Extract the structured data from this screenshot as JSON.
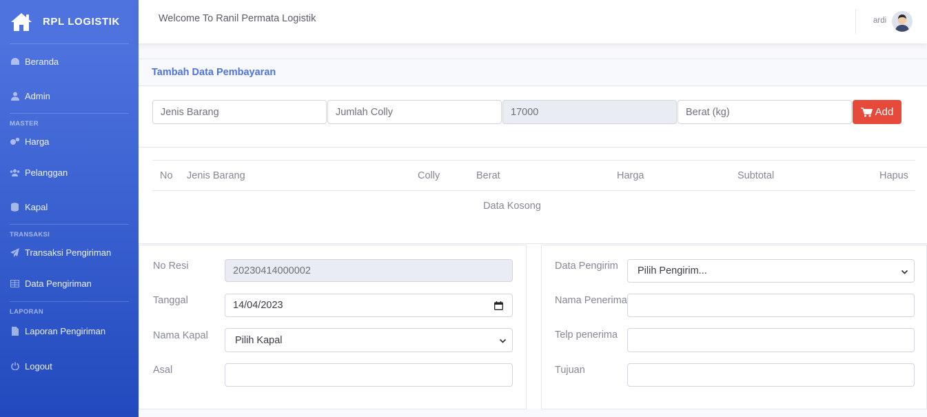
{
  "sidebar": {
    "brand": "RPL LOGISTIK",
    "items": [
      {
        "label": "Beranda",
        "icon": "tachometer-icon"
      },
      {
        "label": "Admin",
        "icon": "user-icon"
      },
      {
        "label": "Harga",
        "icon": "cogs-icon"
      },
      {
        "label": "Pelanggan",
        "icon": "users-icon"
      },
      {
        "label": "Kapal",
        "icon": "database-icon"
      },
      {
        "label": "Transaksi Pengiriman",
        "icon": "paper-plane-icon"
      },
      {
        "label": "Data Pengiriman",
        "icon": "table-icon"
      },
      {
        "label": "Laporan Pengiriman",
        "icon": "file-icon"
      },
      {
        "label": "Logout",
        "icon": "power-icon"
      }
    ],
    "headings": {
      "master": "MASTER",
      "transaksi": "TRANSAKSI",
      "laporan": "LAPORAN"
    }
  },
  "topbar": {
    "welcome": "Welcome To Ranil Permata Logistik",
    "username": "ardi"
  },
  "card": {
    "title": "Tambah Data Pembayaran"
  },
  "item_form": {
    "jenis_placeholder": "Jenis Barang",
    "colly_placeholder": "Jumlah Colly",
    "harga_value": "17000",
    "berat_placeholder": "Berat (kg)",
    "add_label": "Add"
  },
  "table": {
    "headers": [
      "No",
      "Jenis Barang",
      "Colly",
      "Berat",
      "Harga",
      "Subtotal",
      "Hapus"
    ],
    "empty": "Data Kosong"
  },
  "left_form": {
    "no_resi_label": "No Resi",
    "no_resi_value": "20230414000002",
    "tanggal_label": "Tanggal",
    "tanggal_value": "14/04/2023",
    "kapal_label": "Nama Kapal",
    "kapal_value": "Pilih Kapal",
    "asal_label": "Asal"
  },
  "right_form": {
    "pengirim_label": "Data Pengirim",
    "pengirim_value": "Pilih Pengirim...",
    "penerima_label": "Nama Penerima",
    "telp_label": "Telp penerima",
    "tujuan_label": "Tujuan"
  },
  "colors": {
    "primary": "#4e73df",
    "danger": "#e74a3b",
    "sidebar_end": "#224abe"
  }
}
